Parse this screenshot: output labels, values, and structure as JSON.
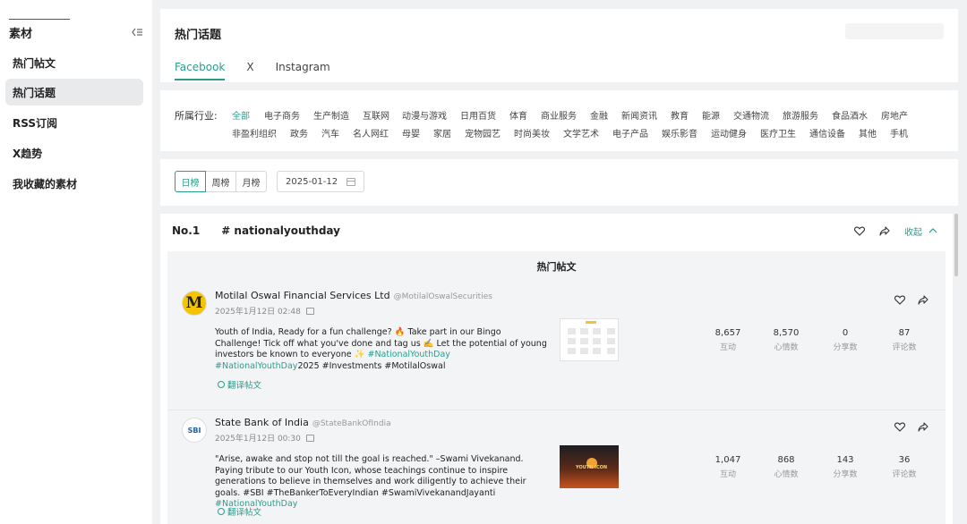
{
  "sidebar": {
    "title": "素材",
    "items": [
      {
        "label": "热门帖文",
        "active": false
      },
      {
        "label": "热门话题",
        "active": true
      },
      {
        "label": "RSS订阅",
        "active": false
      },
      {
        "label": "X趋势",
        "active": false
      },
      {
        "label": "我收藏的素材",
        "active": false
      }
    ]
  },
  "header": {
    "title": "热门话题",
    "tabs": [
      {
        "label": "Facebook",
        "active": true
      },
      {
        "label": "X",
        "active": false
      },
      {
        "label": "Instagram",
        "active": false
      }
    ]
  },
  "industry": {
    "label": "所属行业:",
    "row1": [
      "全部",
      "电子商务",
      "生产制造",
      "互联网",
      "动漫与游戏",
      "日用百货",
      "体育",
      "商业服务",
      "金融",
      "新闻资讯",
      "教育",
      "能源",
      "交通物流",
      "旅游服务",
      "食品酒水",
      "房地产"
    ],
    "row2": [
      "非盈利组织",
      "政务",
      "汽车",
      "名人网红",
      "母婴",
      "家居",
      "宠物园艺",
      "时尚美妆",
      "文学艺术",
      "电子产品",
      "娱乐影音",
      "运动健身",
      "医疗卫生",
      "通信设备",
      "其他",
      "手机"
    ],
    "active": "全部"
  },
  "filter": {
    "periods": [
      {
        "label": "日榜",
        "active": true
      },
      {
        "label": "周榜",
        "active": false
      },
      {
        "label": "月榜",
        "active": false
      }
    ],
    "date": "2025-01-12"
  },
  "topic": {
    "rank": "No.1",
    "name": "# nationalyouthday",
    "collapse_label": "收起",
    "posts_title": "热门帖文"
  },
  "posts": [
    {
      "author": "Motilal Oswal Financial Services Ltd",
      "handle": "@MotilalOswalSecurities",
      "time": "2025年1月12日 02:48",
      "avatar_letter": "M",
      "text_plain": "Youth of India, Ready for a fun challenge? 🔥 Take part in our Bingo Challenge! Tick off what you've done and tag us ✍️ Let the potential of young investors be known to everyone ✨ ",
      "tag1": "#NationalYouthDay",
      "tag2": "#NationalYouthDay",
      "text_tail": "2025 #Investments #MotilalOswal",
      "translate": "翻译帖文",
      "stats": [
        {
          "value": "8,657",
          "label": "互动"
        },
        {
          "value": "8,570",
          "label": "心情数"
        },
        {
          "value": "0",
          "label": "分享数"
        },
        {
          "value": "87",
          "label": "评论数"
        }
      ]
    },
    {
      "author": "State Bank of India",
      "handle": "@StateBankOfIndia",
      "time": "2025年1月12日 00:30",
      "avatar_letter": "SBI",
      "text_plain": "\"Arise, awake and stop not till the goal is reached.\" –Swami Vivekanand. Paying tribute to our Youth Icon, whose teachings continue to inspire generations to believe in themselves and work diligently to achieve their goals. #SBI #TheBankerToEveryIndian #SwamiVivekanandJayanti ",
      "tag1": "#NationalYouthDay",
      "thumb_text": "YOUTH ICON",
      "translate": "翻译帖文",
      "stats": [
        {
          "value": "1,047",
          "label": "互动"
        },
        {
          "value": "868",
          "label": "心情数"
        },
        {
          "value": "143",
          "label": "分享数"
        },
        {
          "value": "36",
          "label": "评论数"
        }
      ]
    }
  ]
}
